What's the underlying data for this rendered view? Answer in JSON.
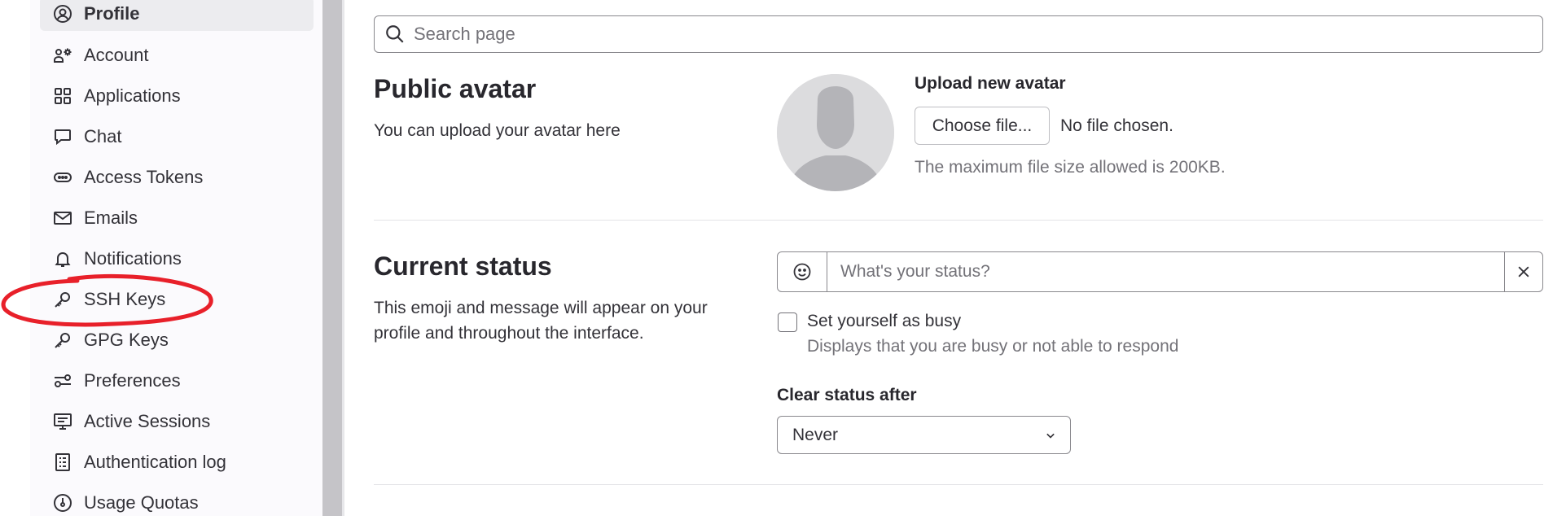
{
  "sidebar": {
    "items": [
      {
        "label": "Profile",
        "icon": "profile-icon",
        "active": true
      },
      {
        "label": "Account",
        "icon": "account-icon"
      },
      {
        "label": "Applications",
        "icon": "applications-icon"
      },
      {
        "label": "Chat",
        "icon": "chat-icon"
      },
      {
        "label": "Access Tokens",
        "icon": "token-icon"
      },
      {
        "label": "Emails",
        "icon": "mail-icon"
      },
      {
        "label": "Notifications",
        "icon": "bell-icon"
      },
      {
        "label": "SSH Keys",
        "icon": "key-icon"
      },
      {
        "label": "GPG Keys",
        "icon": "key-icon"
      },
      {
        "label": "Preferences",
        "icon": "preferences-icon"
      },
      {
        "label": "Active Sessions",
        "icon": "monitor-icon"
      },
      {
        "label": "Authentication log",
        "icon": "log-icon"
      },
      {
        "label": "Usage Quotas",
        "icon": "gauge-icon"
      }
    ]
  },
  "search": {
    "placeholder": "Search page"
  },
  "avatar_section": {
    "title": "Public avatar",
    "description": "You can upload your avatar here",
    "upload_label": "Upload new avatar",
    "choose_button": "Choose file...",
    "no_file": "No file chosen.",
    "help": "The maximum file size allowed is 200KB."
  },
  "status_section": {
    "title": "Current status",
    "description": "This emoji and message will appear on your profile and throughout the interface.",
    "placeholder": "What's your status?",
    "busy_label": "Set yourself as busy",
    "busy_help": "Displays that you are busy or not able to respond",
    "clear_label": "Clear status after",
    "clear_value": "Never"
  },
  "colors": {
    "annotation": "#e8202a",
    "active_bg": "#ececef",
    "text": "#333238"
  }
}
